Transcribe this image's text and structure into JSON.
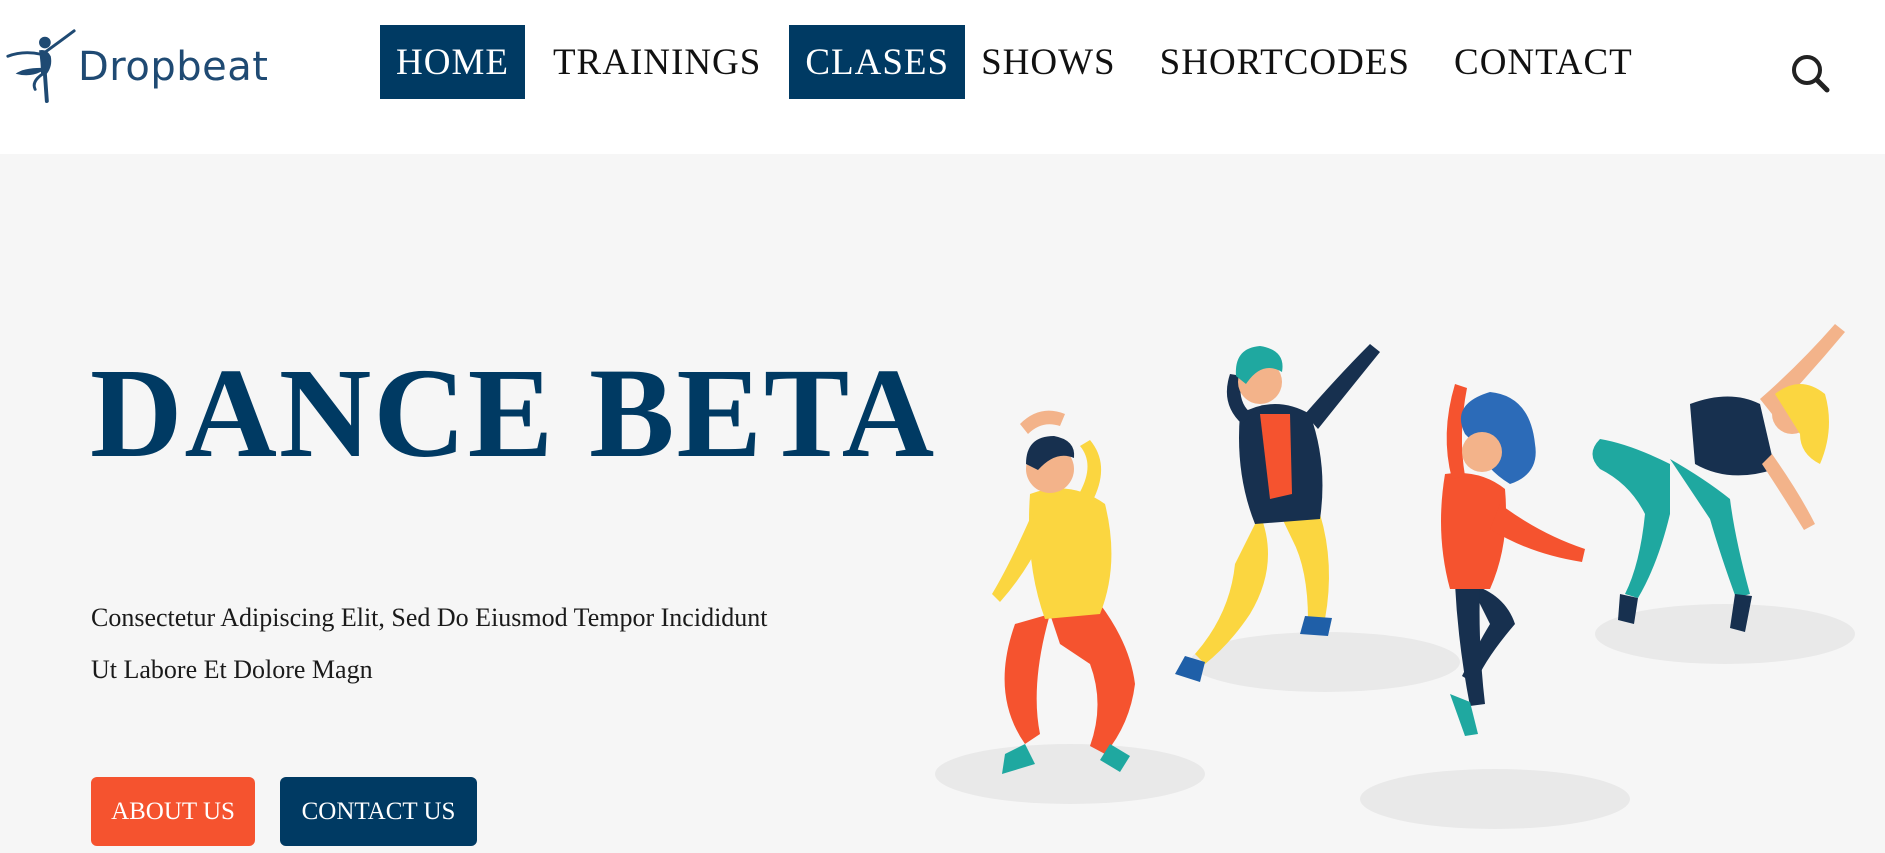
{
  "brand": {
    "name": "Dropbeat"
  },
  "nav": {
    "items": [
      {
        "label": "HOME"
      },
      {
        "label": "TRAININGS"
      },
      {
        "label": "CLASES"
      },
      {
        "label": "SHOWS"
      },
      {
        "label": "SHORTCODES"
      },
      {
        "label": "CONTACT"
      }
    ]
  },
  "hero": {
    "title": "DANCE BETA",
    "description_line1": "Consectetur Adipiscing Elit, Sed Do Eiusmod Tempor Incididunt",
    "description_line2": "Ut Labore Et Dolore Magn",
    "about_button": "ABOUT US",
    "contact_button": "CONTACT US"
  },
  "icons": {
    "logo": "ballerina-logo-icon",
    "search": "search-icon"
  },
  "colors": {
    "primary": "#003a63",
    "accent": "#f5532f",
    "hero_bg": "#f6f6f6"
  }
}
